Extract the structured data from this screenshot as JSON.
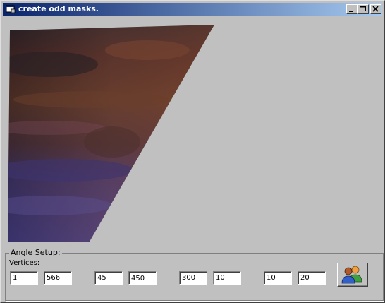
{
  "window": {
    "title": "create odd masks.",
    "icon": "app-window-icon",
    "controls": [
      "minimize-icon",
      "maximize-icon",
      "close-icon"
    ]
  },
  "canvas": {
    "image": "masked-texture-image",
    "colors": {
      "top": "#3b2a2e",
      "brown": "#6b3e2c",
      "purple": "#4b3f7a"
    }
  },
  "angle_setup": {
    "legend": "Angle Setup:",
    "vertices_label": "Vertices:",
    "fields": [
      "1",
      "566",
      "45",
      "450",
      "300",
      "10",
      "10",
      "20"
    ],
    "action_icon": "users-icon"
  }
}
